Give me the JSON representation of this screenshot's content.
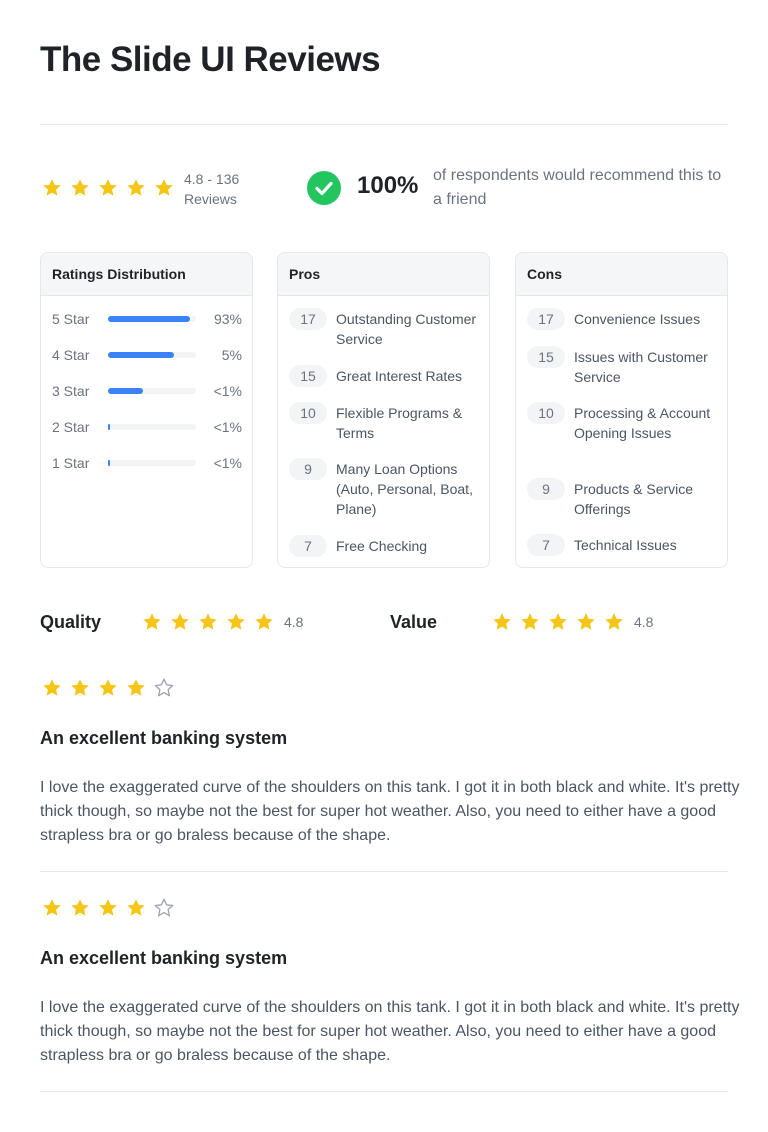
{
  "page": {
    "title": "The Slide UI Reviews"
  },
  "colors": {
    "star": "#F5C518",
    "star_empty": "#9CA3AF",
    "bar": "#3B82F6",
    "check": "#22C55E"
  },
  "summary": {
    "rating": 4.8,
    "rating_text": "4.8 - 136 Reviews",
    "recommend_percent": "100%",
    "recommend_text": "of respondents would recommend this to a friend",
    "check_icon": "check-circle-icon"
  },
  "distribution": {
    "title": "Ratings Distribution",
    "rows": [
      {
        "label": "5 Star",
        "percent": "93%",
        "fill": 0.93
      },
      {
        "label": "4 Star",
        "percent": "5%",
        "fill": 0.75
      },
      {
        "label": "3 Star",
        "percent": "<1%",
        "fill": 0.4
      },
      {
        "label": "2 Star",
        "percent": "<1%",
        "fill": 0.02
      },
      {
        "label": "1 Star",
        "percent": "<1%",
        "fill": 0.02
      }
    ]
  },
  "pros": {
    "title": "Pros",
    "items": [
      {
        "count": "17",
        "label": "Outstanding Customer Service"
      },
      {
        "count": "15",
        "label": "Great Interest Rates"
      },
      {
        "count": "10",
        "label": "Flexible Programs & Terms"
      },
      {
        "count": "9",
        "label": "Many Loan Options (Auto, Personal, Boat, Plane)"
      },
      {
        "count": "7",
        "label": "Free Checking"
      }
    ]
  },
  "cons": {
    "title": "Cons",
    "items": [
      {
        "count": "17",
        "label": "Convenience Issues"
      },
      {
        "count": "15",
        "label": "Issues with Customer Service"
      },
      {
        "count": "10",
        "label": "Processing & Account Opening Issues"
      },
      {
        "count": "9",
        "label": "Products & Service Offerings"
      },
      {
        "count": "7",
        "label": "Technical Issues"
      }
    ]
  },
  "metrics": [
    {
      "label": "Quality",
      "value": "4.8",
      "stars": 5
    },
    {
      "label": "Value",
      "value": "4.8",
      "stars": 5
    }
  ],
  "reviews": [
    {
      "stars": 4,
      "title": "An excellent banking system",
      "body": "I love the exaggerated curve of the shoulders on this tank. I got it in both black and white. It's pretty thick though, so maybe not the best for super hot weather. Also, you need to either have a good strapless bra or go braless because of the shape."
    },
    {
      "stars": 4,
      "title": "An excellent banking system",
      "body": "I love the exaggerated curve of the shoulders on this tank. I got it in both black and white. It's pretty thick though, so maybe not the best for super hot weather. Also, you need to either have a good strapless bra or go braless because of the shape."
    }
  ]
}
